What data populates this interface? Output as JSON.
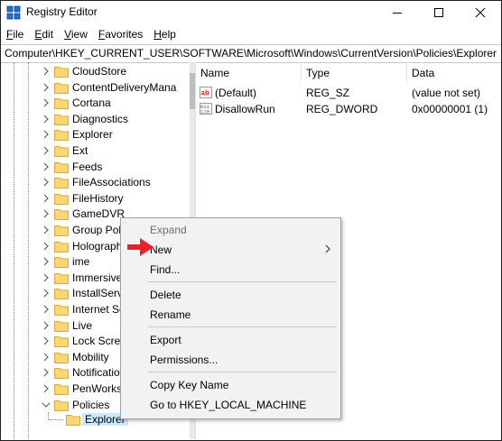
{
  "window": {
    "title": "Registry Editor"
  },
  "menubar": [
    {
      "underline": "F",
      "rest": "ile"
    },
    {
      "underline": "E",
      "rest": "dit"
    },
    {
      "underline": "V",
      "rest": "iew"
    },
    {
      "underline": "F",
      "rest": "avorites"
    },
    {
      "underline": "H",
      "rest": "elp"
    }
  ],
  "address": "Computer\\HKEY_CURRENT_USER\\SOFTWARE\\Microsoft\\Windows\\CurrentVersion\\Policies\\Explorer",
  "tree": {
    "items": [
      {
        "label": "CloudStore"
      },
      {
        "label": "ContentDeliveryMana"
      },
      {
        "label": "Cortana"
      },
      {
        "label": "Diagnostics"
      },
      {
        "label": "Explorer"
      },
      {
        "label": "Ext"
      },
      {
        "label": "Feeds"
      },
      {
        "label": "FileAssociations"
      },
      {
        "label": "FileHistory"
      },
      {
        "label": "GameDVR"
      },
      {
        "label": "Group Pol"
      },
      {
        "label": "Holograph"
      },
      {
        "label": "ime"
      },
      {
        "label": "Immersive"
      },
      {
        "label": "InstallServ"
      },
      {
        "label": "Internet Se"
      },
      {
        "label": "Live"
      },
      {
        "label": "Lock Scree"
      },
      {
        "label": "Mobility"
      },
      {
        "label": "Notificatio"
      },
      {
        "label": "PenWorks"
      },
      {
        "label": "Policies"
      }
    ],
    "selected_child": "Explorer"
  },
  "values": {
    "headers": {
      "name": "Name",
      "type": "Type",
      "data": "Data"
    },
    "rows": [
      {
        "name": "(Default)",
        "type": "REG_SZ",
        "data": "(value not set)",
        "icon": "string-value-icon"
      },
      {
        "name": "DisallowRun",
        "type": "REG_DWORD",
        "data": "0x00000001 (1)",
        "icon": "dword-value-icon"
      }
    ]
  },
  "context_menu": {
    "items": [
      {
        "label": "Expand",
        "disabled": true
      },
      {
        "label": "New",
        "submenu": true
      },
      {
        "label": "Find..."
      },
      {
        "label": "Delete"
      },
      {
        "label": "Rename"
      },
      {
        "label": "Export"
      },
      {
        "label": "Permissions..."
      },
      {
        "label": "Copy Key Name"
      },
      {
        "label": "Go to HKEY_LOCAL_MACHINE"
      }
    ]
  },
  "colors": {
    "selection": "#cce8ff",
    "folder": "#f8d775",
    "menu_bg": "#f2f2f2",
    "arrow": "#e8202a"
  }
}
